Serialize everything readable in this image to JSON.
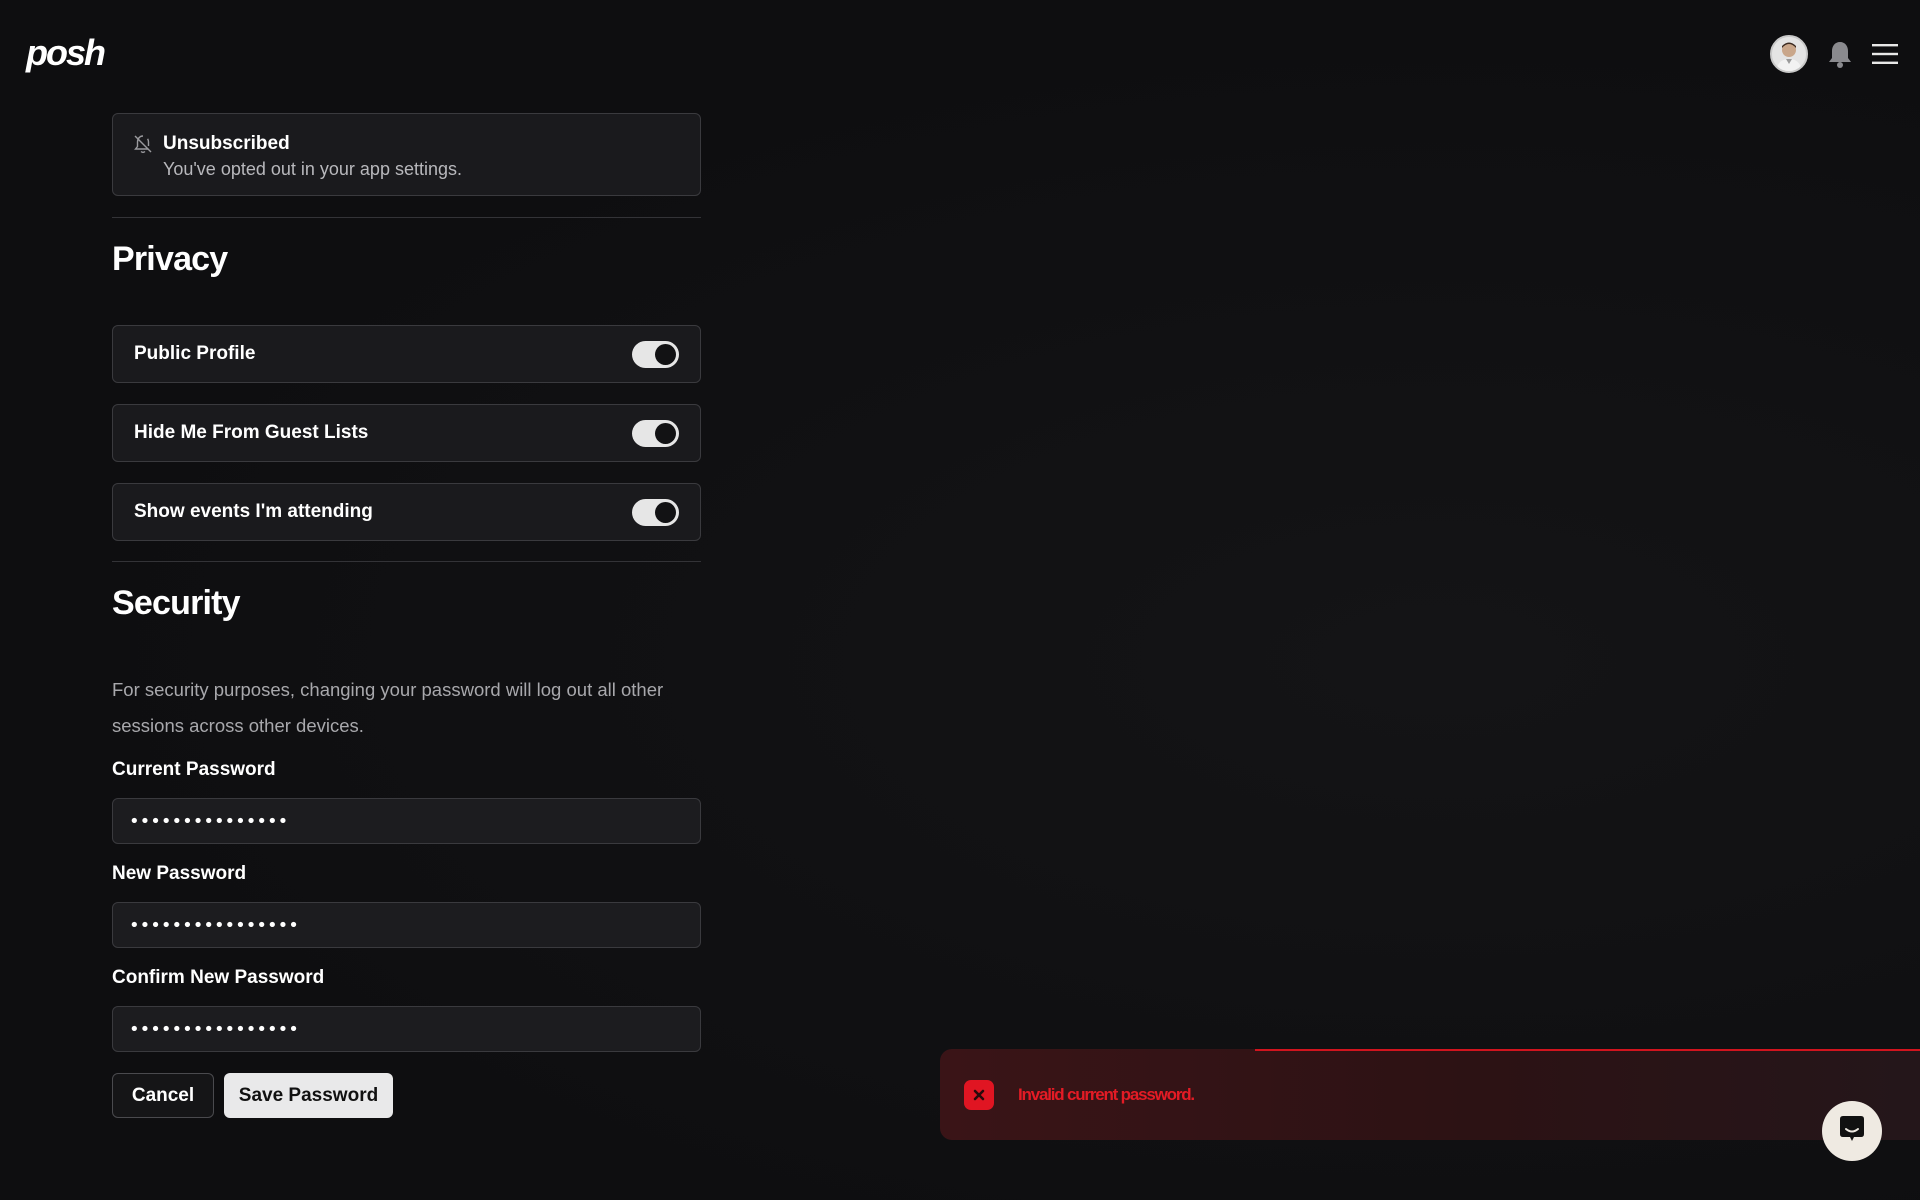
{
  "header": {
    "logo": "posh",
    "icons": [
      "avatar",
      "bell-icon",
      "menu-icon"
    ]
  },
  "notifications": {
    "status_title": "Unsubscribed",
    "status_subtitle": "You've opted out in your app settings.",
    "icon": "bell-off-icon"
  },
  "privacy": {
    "title": "Privacy",
    "toggles": [
      {
        "label": "Public Profile",
        "on": true
      },
      {
        "label": "Hide Me From Guest Lists",
        "on": true
      },
      {
        "label": "Show events I'm attending",
        "on": true
      }
    ]
  },
  "security": {
    "title": "Security",
    "description": "For security purposes, changing your password will log out all other sessions across other devices.",
    "current_password_label": "Current Password",
    "current_password_value": "•••••••••••••••",
    "new_password_label": "New Password",
    "new_password_value": "••••••••••••••••",
    "confirm_password_label": "Confirm New Password",
    "confirm_password_value": "••••••••••••••••",
    "cancel_label": "Cancel",
    "save_label": "Save Password"
  },
  "toast": {
    "message": "Invalid current password.",
    "icon": "close-icon",
    "color": "#e01522"
  },
  "chat": {
    "icon": "chat-icon"
  }
}
